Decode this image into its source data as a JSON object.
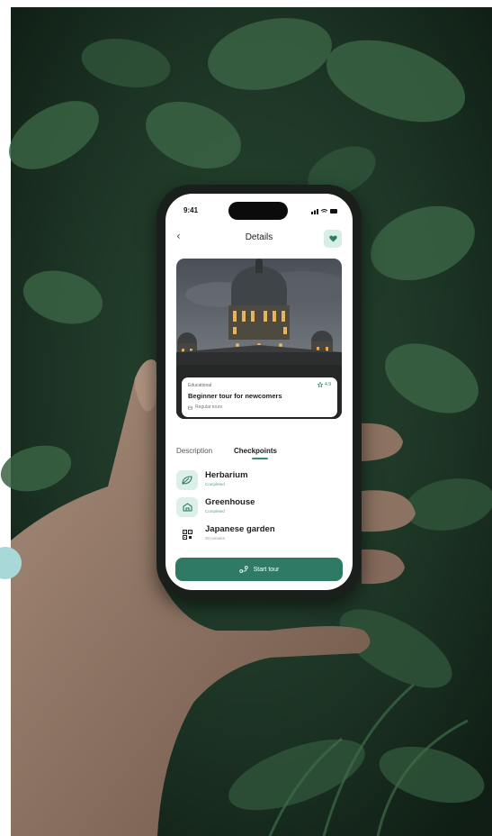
{
  "status_bar": {
    "time": "9:41"
  },
  "header": {
    "title": "Details"
  },
  "tour": {
    "category": "Educational",
    "rating": "4.9",
    "title": "Beginner tour for newcomers",
    "subtitle": "Regular tours"
  },
  "tabs": [
    {
      "label": "Description",
      "active": false
    },
    {
      "label": "Checkpoints",
      "active": true
    }
  ],
  "checkpoints": [
    {
      "name": "Herbarium",
      "status": "Completed",
      "icon": "leaf-icon"
    },
    {
      "name": "Greenhouse",
      "status": "Completed",
      "icon": "greenhouse-icon"
    },
    {
      "name": "Japanese garden",
      "status": "30 minutes",
      "icon": "qr-code-icon"
    }
  ],
  "actions": {
    "start_label": "Start tour",
    "start_icon": "route-icon"
  },
  "colors": {
    "accent": "#2e7a65",
    "accent_light": "#dcefe8",
    "foliage": "#1e3a27"
  }
}
